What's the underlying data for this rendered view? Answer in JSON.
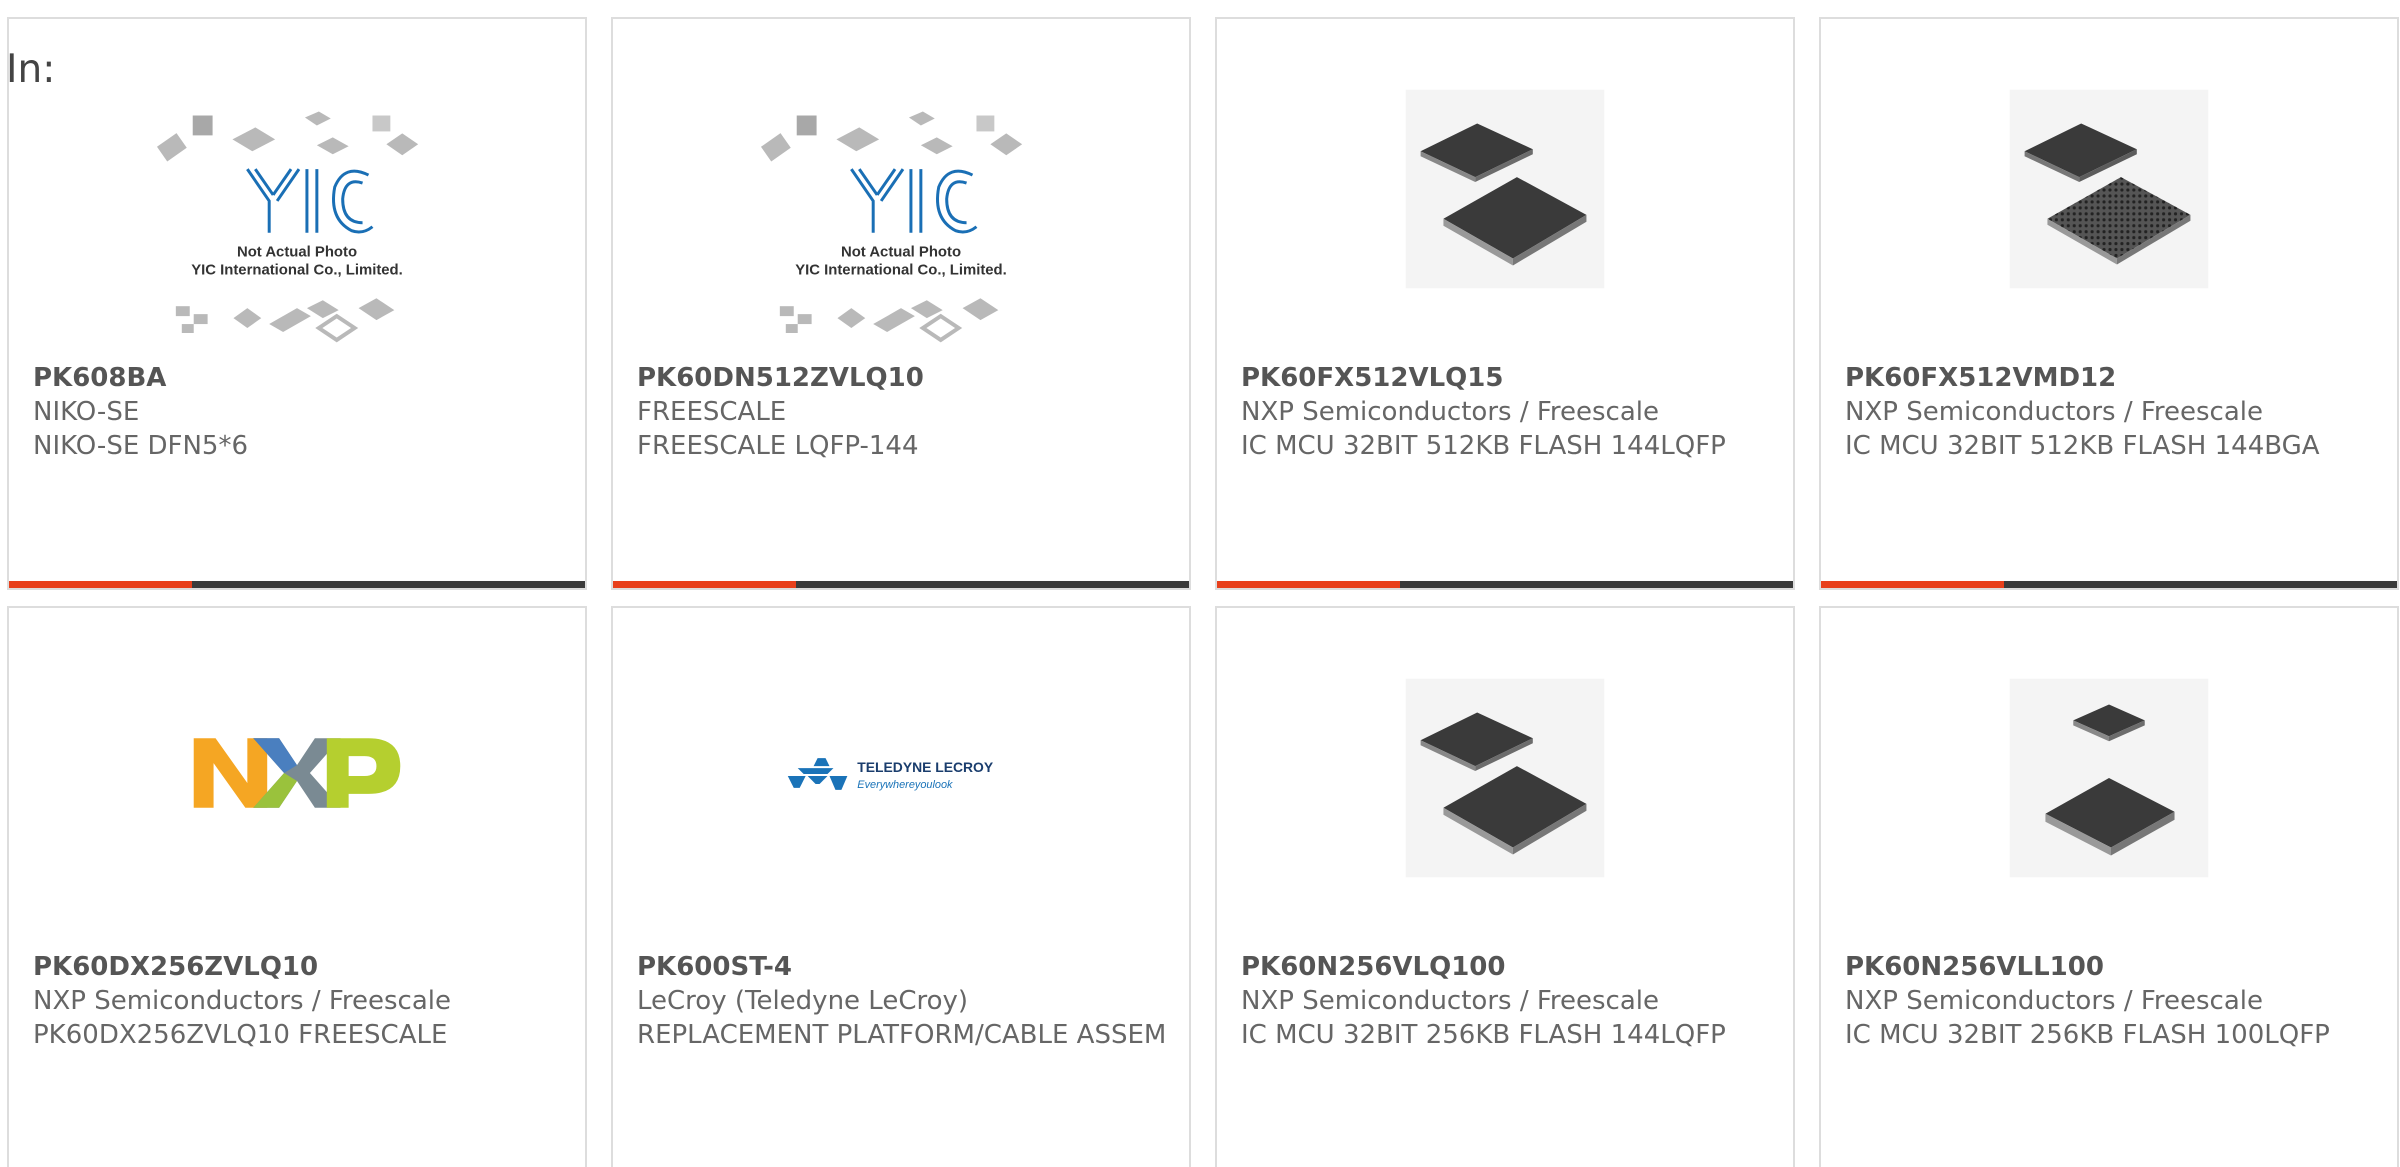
{
  "prefix": "In:",
  "products": [
    {
      "part_number": "PK608BA",
      "manufacturer": "NIKO-SE",
      "description": "NIKO-SE DFN5*6",
      "image": "yic-placeholder",
      "image_caption_1": "Not Actual Photo",
      "image_caption_2": "YIC International Co., Limited."
    },
    {
      "part_number": "PK60DN512ZVLQ10",
      "manufacturer": "FREESCALE",
      "description": "FREESCALE LQFP-144",
      "image": "yic-placeholder",
      "image_caption_1": "Not Actual Photo",
      "image_caption_2": "YIC International Co., Limited."
    },
    {
      "part_number": "PK60FX512VLQ15",
      "manufacturer": "NXP Semiconductors / Freescale",
      "description": "IC MCU 32BIT 512KB FLASH 144LQFP",
      "image": "lqfp-chip-photo"
    },
    {
      "part_number": "PK60FX512VMD12",
      "manufacturer": "NXP Semiconductors / Freescale",
      "description": "IC MCU 32BIT 512KB FLASH 144BGA",
      "image": "bga-chip-photo"
    },
    {
      "part_number": "PK60DX256ZVLQ10",
      "manufacturer": "NXP Semiconductors / Freescale",
      "description": "PK60DX256ZVLQ10 FREESCALE",
      "image": "nxp-logo"
    },
    {
      "part_number": "PK600ST-4",
      "manufacturer": "LeCroy (Teledyne LeCroy)",
      "description": "REPLACEMENT PLATFORM/CABLE ASSEM",
      "image": "teledyne-lecroy-logo",
      "logo_text_1": "TELEDYNE LECROY",
      "logo_text_2": "Everywhereyoulook"
    },
    {
      "part_number": "PK60N256VLQ100",
      "manufacturer": "NXP Semiconductors / Freescale",
      "description": "IC MCU 32BIT 256KB FLASH 144LQFP",
      "image": "lqfp-chip-photo"
    },
    {
      "part_number": "PK60N256VLL100",
      "manufacturer": "NXP Semiconductors / Freescale",
      "description": "IC MCU 32BIT 256KB FLASH 100LQFP",
      "image": "lqfp-chip-photo"
    }
  ],
  "colors": {
    "accent": "#e8401c",
    "bar": "#3b3b3b",
    "border": "#dddddd",
    "yic_blue": "#1a6fb5"
  }
}
